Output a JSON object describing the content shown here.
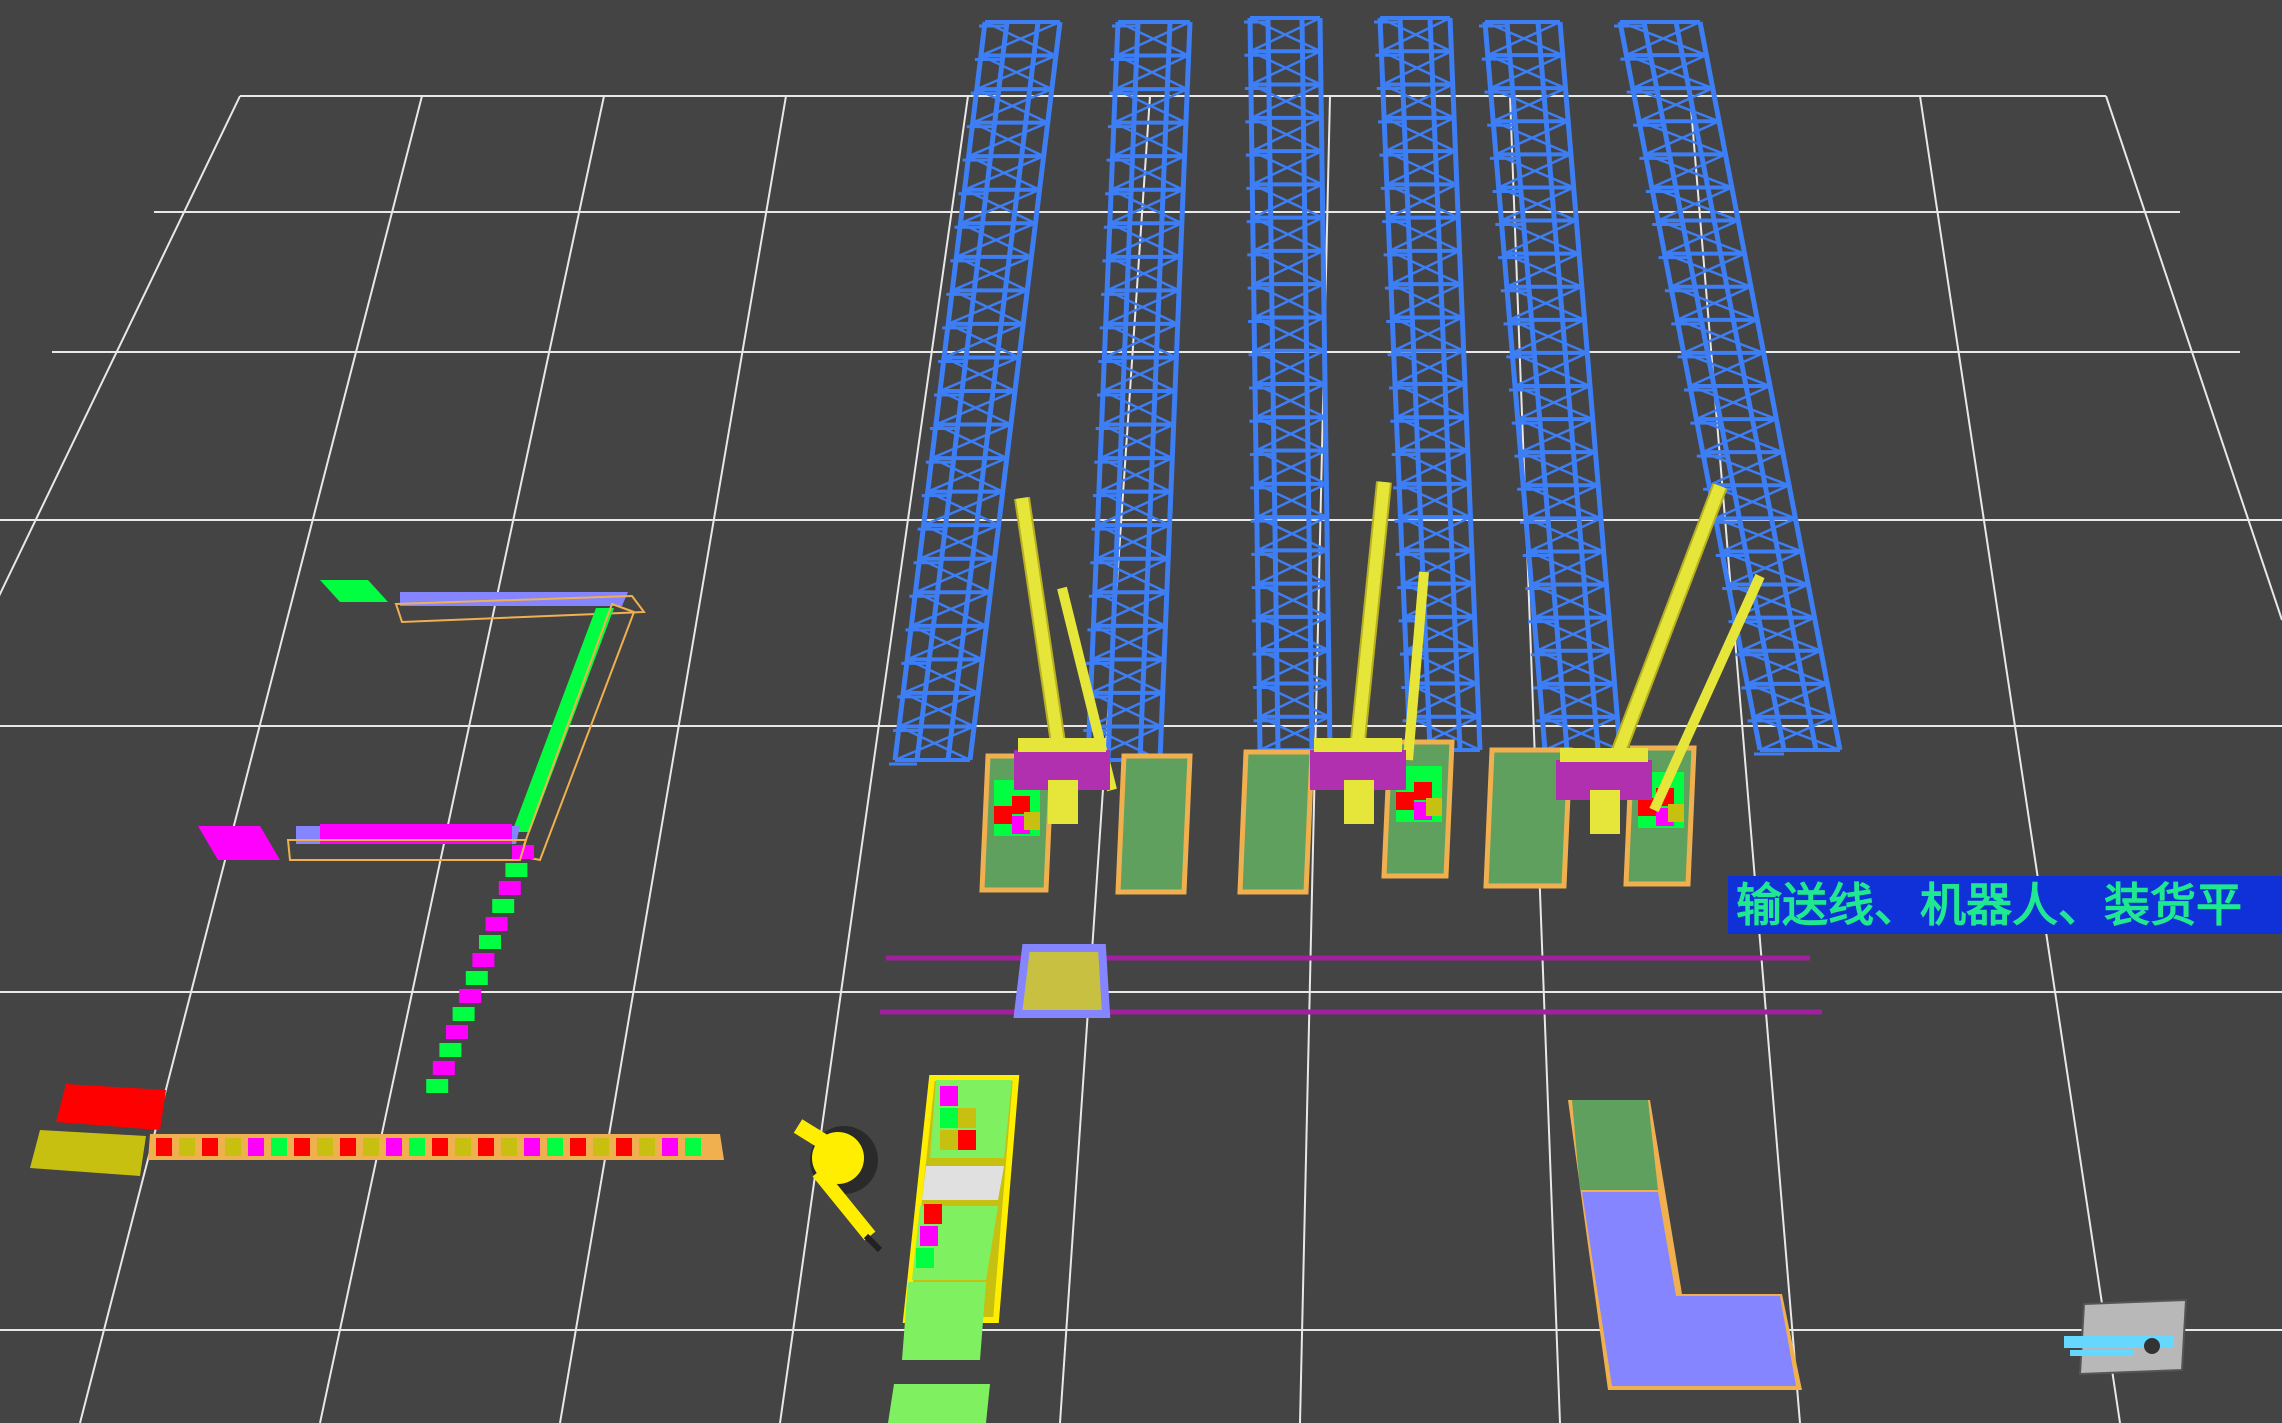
{
  "viewport": {
    "label": "输送线、机器人、装货平",
    "background": "#444444",
    "grid_color": "#e8e8e8"
  },
  "colors": {
    "rack": "#3d7ef5",
    "stacker": "#e6e63a",
    "stacker_base": "#b030b0",
    "station_surface": "#5fa05f",
    "station_frame": "#f0b050",
    "conveyor_tray": "#8585ff",
    "rail": "#a020a0",
    "cart": "#c8c040",
    "box_red": "#ff0000",
    "box_green": "#00ff40",
    "box_magenta": "#ff00ff",
    "box_olive": "#c8c010",
    "robot_arm": "#ffee00",
    "l_platform": "#8585ff",
    "worker_shirt": "#66d8ff"
  },
  "objects": {
    "racks": "rack-rows",
    "stackers": "stacker-cranes",
    "conveyor": "conveyor-line",
    "robot": "robot-arm-icon",
    "worker": "worker-icon",
    "platform": "loading-platform"
  }
}
